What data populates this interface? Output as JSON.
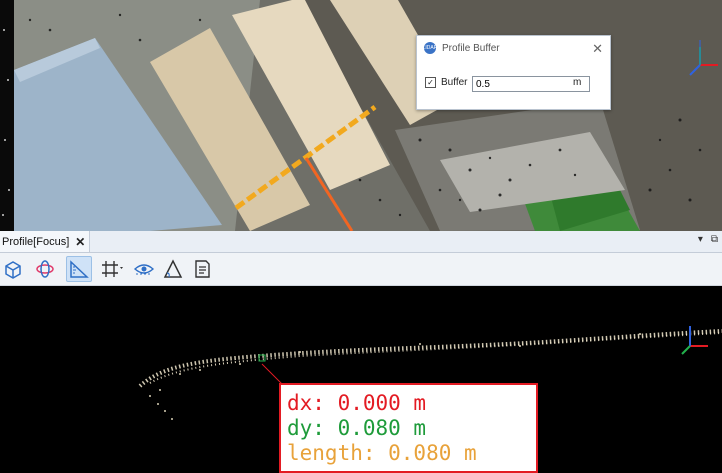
{
  "dialog": {
    "title": "Profile Buffer",
    "logo_text": "LIDAR",
    "close_glyph": "✕",
    "buffer_checked": true,
    "checkbox_glyph": "✓",
    "buffer_label": "Buffer",
    "buffer_value": "0.5",
    "buffer_unit": "m"
  },
  "panel": {
    "tab_label": "Profile[Focus]",
    "tab_close": "✕",
    "header_icons": [
      "▾",
      "⧉"
    ]
  },
  "toolbar": {
    "tools": [
      {
        "name": "3d-view-icon",
        "active": false
      },
      {
        "name": "orbit-icon",
        "active": false
      },
      {
        "name": "measure-ruler-icon",
        "active": true
      },
      {
        "name": "grid-select-icon",
        "active": false
      },
      {
        "name": "visibility-icon",
        "active": false
      },
      {
        "name": "angle-icon",
        "active": false
      },
      {
        "name": "report-icon",
        "active": false
      }
    ]
  },
  "measurement": {
    "dx_text": "dx: 0.000 m",
    "dy_text": "dy: 0.080 m",
    "length_text": "length: 0.080 m",
    "colors": {
      "dx": "#e31b23",
      "dy": "#1e9b3a",
      "length": "#e8a23a",
      "border": "#e31b23"
    }
  },
  "colors": {
    "profile_line": "#f2a91e",
    "profile_direction": "#f26522",
    "axis_x": "#e31b23",
    "axis_y": "#22b14c",
    "axis_z": "#2f62e0"
  }
}
